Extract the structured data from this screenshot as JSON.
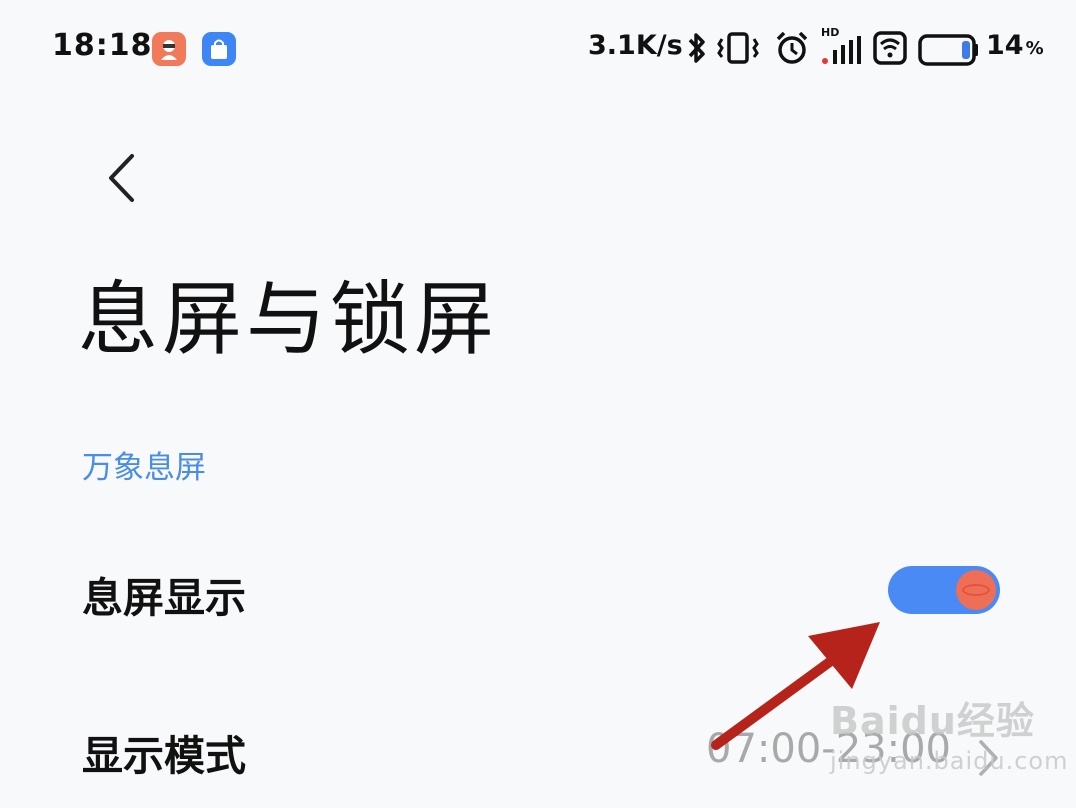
{
  "status_bar": {
    "time": "18:18",
    "network_speed": "3.1K/s",
    "signal_label": "HD",
    "battery_percent": "14",
    "battery_unit": "%",
    "icons": [
      "bluetooth-icon",
      "vibrate-icon",
      "alarm-icon",
      "signal-icon",
      "wifi-icon",
      "battery-icon"
    ]
  },
  "header": {
    "back_icon": "chevron-left-icon",
    "title": "息屏与锁屏"
  },
  "section": {
    "title": "万象息屏"
  },
  "settings": [
    {
      "label": "息屏显示",
      "control": "toggle",
      "on": true
    },
    {
      "label": "显示模式",
      "value": "07:00-23:00"
    }
  ],
  "watermark": {
    "logo": "Baidu经验",
    "site": "jingyan.baidu.com"
  },
  "colors": {
    "accent": "#4a8af4",
    "section_header": "#4a8de8",
    "toggle_knob": "#ee6f55",
    "annotation_arrow": "#b5231a",
    "background": "#f8f9fb"
  }
}
